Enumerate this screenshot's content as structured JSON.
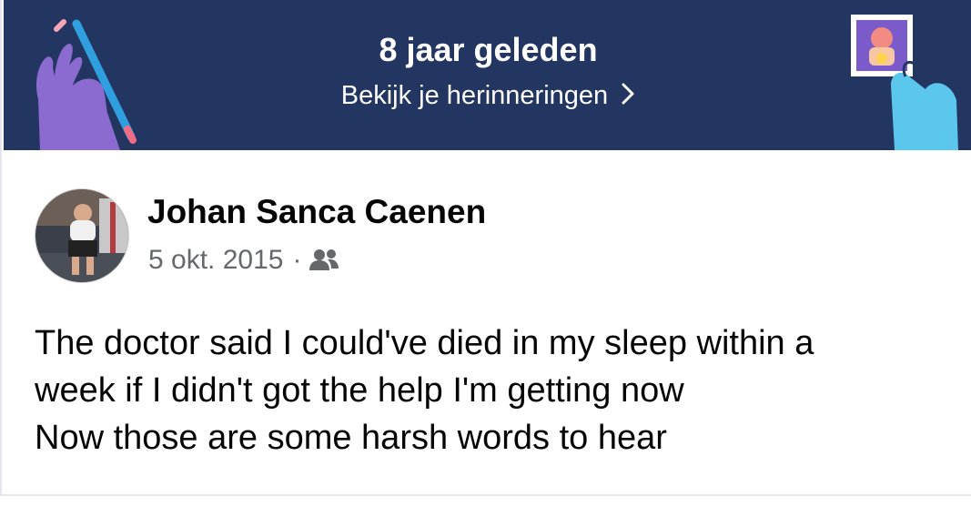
{
  "memory_banner": {
    "title": "8 jaar geleden",
    "link_label": "Bekijk je herinneringen",
    "background_color": "#233561"
  },
  "post": {
    "author_name": "Johan Sanca Caenen",
    "date": "5 okt. 2015",
    "separator": "·",
    "audience_icon": "friends-icon",
    "text_lines": [
      "The doctor said I could've died in my sleep within a",
      "week if I didn't got the help I'm getting now",
      "Now those are some harsh words to hear"
    ]
  }
}
